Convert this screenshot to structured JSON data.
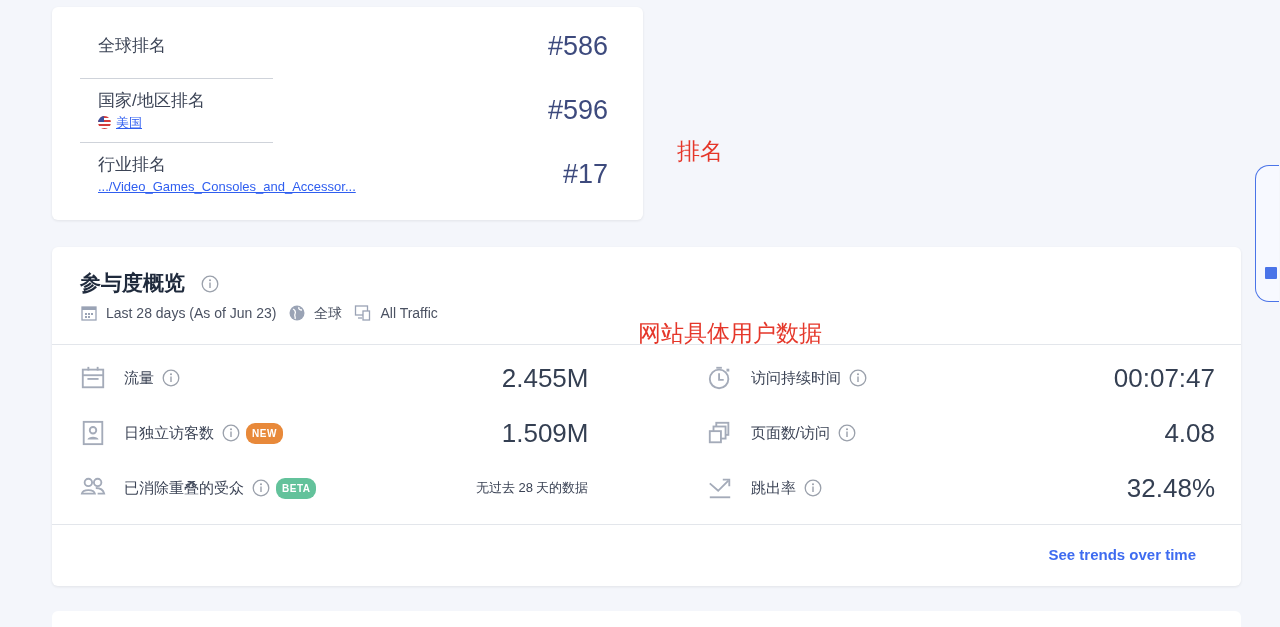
{
  "ranks": [
    {
      "label": "全球排名",
      "value": "#586"
    },
    {
      "label": "国家/地区排名",
      "link": "美国",
      "flag": true,
      "value": "#596"
    },
    {
      "label": "行业排名",
      "link": ".../Video_Games_Consoles_and_Accessor...",
      "value": "#17"
    }
  ],
  "annotations": [
    {
      "text": "排名"
    },
    {
      "text": "网站具体用户数据"
    }
  ],
  "engagement": {
    "title": "参与度概览",
    "filters": [
      {
        "kind": "date",
        "text": "Last 28 days (As of Jun 23)"
      },
      {
        "kind": "globe",
        "text": "全球"
      },
      {
        "kind": "device",
        "text": "All Traffic"
      }
    ],
    "metrics": [
      {
        "kind": "visits",
        "label": "流量",
        "value": "2.455M"
      },
      {
        "kind": "duration",
        "label": "访问持续时间",
        "value": "00:07:47"
      },
      {
        "kind": "unique",
        "label": "日独立访客数",
        "badge": {
          "text": "NEW",
          "color": "#e8893a"
        },
        "value": "1.509M"
      },
      {
        "kind": "pages",
        "label": "页面数/访问",
        "value": "4.08"
      },
      {
        "kind": "audience",
        "label": "已消除重叠的受众",
        "badge": {
          "text": "BETA",
          "color": "#63c29b"
        },
        "note": "无过去 28 天的数据"
      },
      {
        "kind": "bounce",
        "label": "跳出率",
        "value": "32.48%"
      }
    ],
    "link": "See trends over time"
  }
}
